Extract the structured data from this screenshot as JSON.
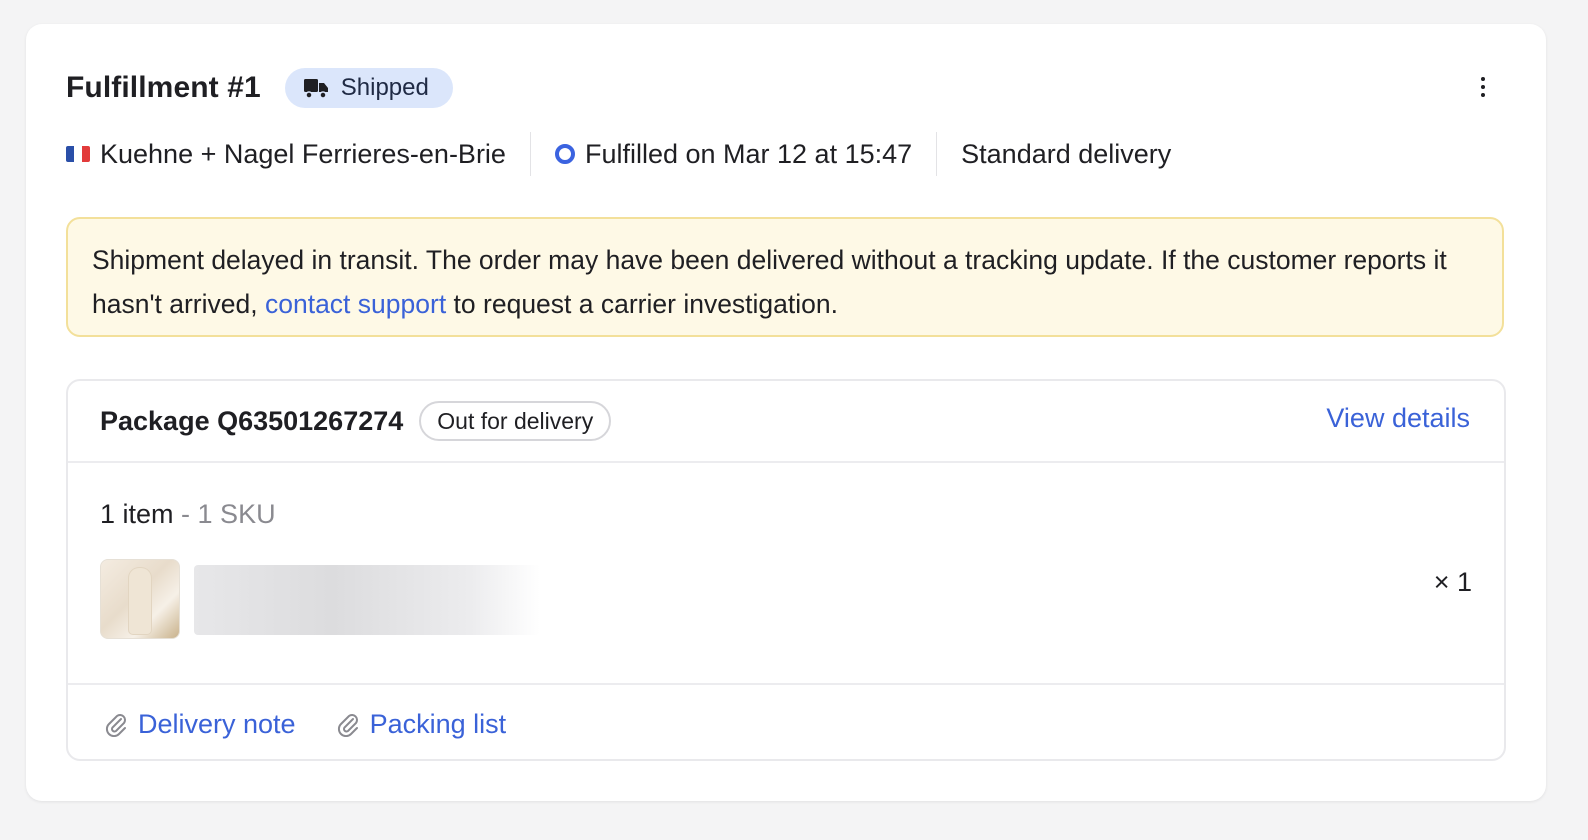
{
  "fulfillment": {
    "title": "Fulfillment #1",
    "status": "Shipped",
    "status_icon": "truck-icon",
    "more_icon": "more-vertical-icon"
  },
  "meta": {
    "location_flag": "france-flag-icon",
    "location": "Kuehne + Nagel Ferrieres-en-Brie",
    "fulfilled_icon": "status-dot-icon",
    "fulfilled": "Fulfilled on Mar 12 at 15:47",
    "delivery_method": "Standard delivery"
  },
  "alert": {
    "text_before": "Shipment delayed in transit. The order may have been delivered without a tracking update. If the customer reports it hasn't arrived, ",
    "link": "contact support",
    "text_after": " to request a carrier investigation."
  },
  "package": {
    "title": "Package Q63501267274",
    "status": "Out for delivery",
    "view_details": "View details",
    "items_count": "1 item",
    "sku_count": "- 1 SKU",
    "line_items": [
      {
        "quantity": "× 1",
        "thumbnail": "product-thumbnail"
      }
    ],
    "attachments": [
      {
        "label": "Delivery note",
        "icon": "paperclip-icon"
      },
      {
        "label": "Packing list",
        "icon": "paperclip-icon"
      }
    ]
  },
  "colors": {
    "accent": "#3a62d8",
    "status_badge_bg": "#dbe6fb",
    "alert_bg": "#fef9e6",
    "alert_border": "#f3e09a"
  }
}
